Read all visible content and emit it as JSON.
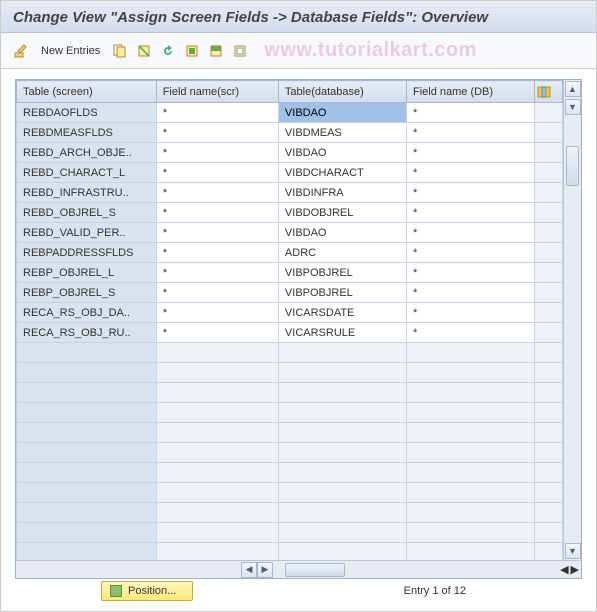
{
  "header": {
    "title": "Change View \"Assign Screen Fields -> Database Fields\": Overview"
  },
  "toolbar": {
    "new_entries_label": "New Entries",
    "watermark": "www.tutorialkart.com"
  },
  "table": {
    "columns": {
      "c1": "Table (screen)",
      "c2": "Field name(scr)",
      "c3": "Table(database)",
      "c4": "Field name (DB)"
    },
    "rows": [
      {
        "c1": "REBDAOFLDS",
        "c2": "*",
        "c3": "VIBDAO",
        "c4": "*",
        "selected": true
      },
      {
        "c1": "REBDMEASFLDS",
        "c2": "*",
        "c3": "VIBDMEAS",
        "c4": "*"
      },
      {
        "c1": "REBD_ARCH_OBJE..",
        "c2": "*",
        "c3": "VIBDAO",
        "c4": "*"
      },
      {
        "c1": "REBD_CHARACT_L",
        "c2": "*",
        "c3": "VIBDCHARACT",
        "c4": "*"
      },
      {
        "c1": "REBD_INFRASTRU..",
        "c2": "*",
        "c3": "VIBDINFRA",
        "c4": "*"
      },
      {
        "c1": "REBD_OBJREL_S",
        "c2": "*",
        "c3": "VIBDOBJREL",
        "c4": "*"
      },
      {
        "c1": "REBD_VALID_PER..",
        "c2": "*",
        "c3": "VIBDAO",
        "c4": "*"
      },
      {
        "c1": "REBPADDRESSFLDS",
        "c2": "*",
        "c3": "ADRC",
        "c4": "*"
      },
      {
        "c1": "REBP_OBJREL_L",
        "c2": "*",
        "c3": "VIBPOBJREL",
        "c4": "*"
      },
      {
        "c1": "REBP_OBJREL_S",
        "c2": "*",
        "c3": "VIBPOBJREL",
        "c4": "*"
      },
      {
        "c1": "RECA_RS_OBJ_DA..",
        "c2": "*",
        "c3": "VICARSDATE",
        "c4": "*"
      },
      {
        "c1": "RECA_RS_OBJ_RU..",
        "c2": "*",
        "c3": "VICARSRULE",
        "c4": "*"
      }
    ],
    "empty_rows": 11
  },
  "footer": {
    "position_label": "Position...",
    "entry_status": "Entry 1 of 12"
  }
}
